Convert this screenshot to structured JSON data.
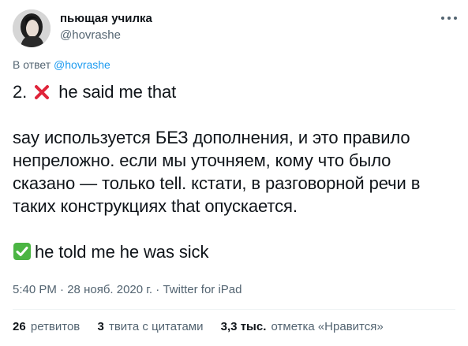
{
  "author": {
    "display_name": "пьющая училка",
    "handle": "@hovrashe"
  },
  "reply": {
    "prefix": "В ответ",
    "mention": "@hovrashe"
  },
  "body": {
    "line1_prefix": "2.",
    "line1_icon": "cross-mark-emoji",
    "line1_suffix": "he said me that",
    "paragraph2_lines": [
      "say используется БЕЗ дополнения, и это правило",
      "непреложно. если мы уточняем, кому что было",
      "сказано — только tell. кстати, в разговорной речи в",
      "таких конструкциях that опускается."
    ],
    "line3_icon": "check-mark-emoji",
    "line3_text": "he told me he was sick"
  },
  "meta": {
    "time": "5:40 PM",
    "separator": "·",
    "date": "28 нояб. 2020 г.",
    "source": "Twitter for iPad"
  },
  "stats": {
    "retweets_count": "26",
    "retweets_label": "ретвитов",
    "quotes_count": "3",
    "quotes_label": "твита с цитатами",
    "likes_count": "3,3 тыс.",
    "likes_label": "отметка «Нравится»"
  },
  "colors": {
    "text": "#0f1419",
    "secondary": "#536471",
    "accent": "#1d9bf0",
    "cross": "#e0243a",
    "check": "#4bb543"
  }
}
